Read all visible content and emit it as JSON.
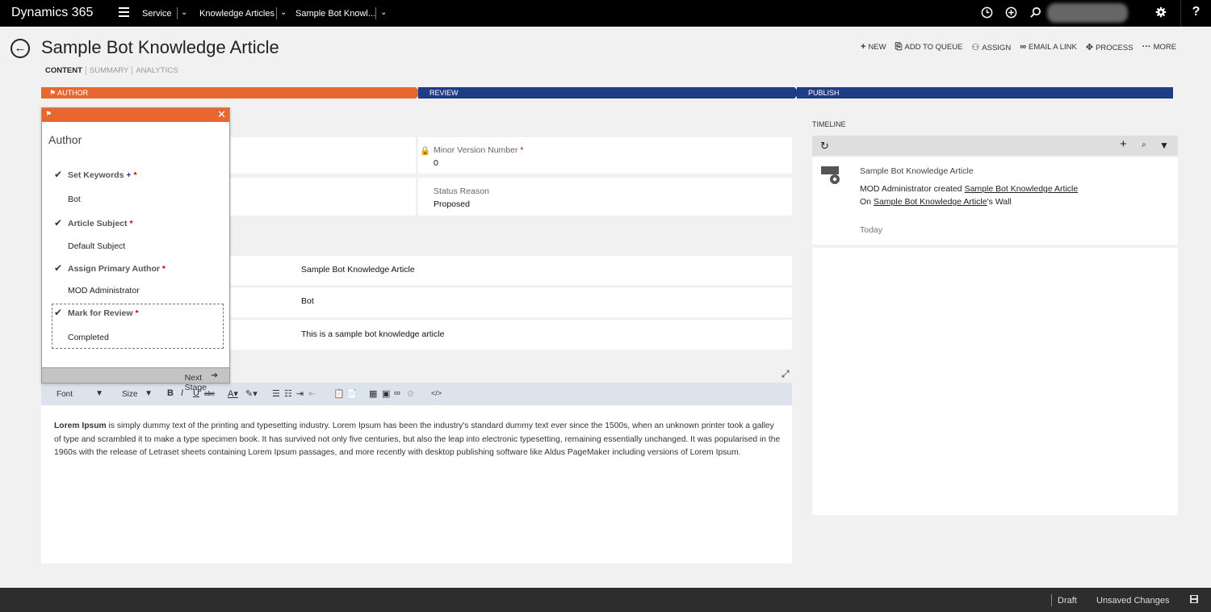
{
  "topbar": {
    "brand": "Dynamics 365",
    "crumbs": [
      "Service",
      "Knowledge Articles",
      "Sample Bot Knowl..."
    ],
    "help": "?"
  },
  "header": {
    "title": "Sample Bot Knowledge Article",
    "tabs": [
      "CONTENT",
      "SUMMARY",
      "ANALYTICS"
    ],
    "commands": [
      {
        "icon": "+",
        "label": "NEW"
      },
      {
        "icon": "⎘",
        "label": "ADD TO QUEUE"
      },
      {
        "icon": "👤",
        "label": "ASSIGN"
      },
      {
        "icon": "∞",
        "label": "EMAIL A LINK"
      },
      {
        "icon": "✥",
        "label": "PROCESS"
      },
      {
        "icon": "···",
        "label": "MORE"
      }
    ]
  },
  "stages": [
    "AUTHOR",
    "REVIEW",
    "PUBLISH"
  ],
  "flyout": {
    "title": "Author",
    "steps": [
      {
        "label": "Set Keywords",
        "value": "Bot"
      },
      {
        "label": "Article Subject",
        "value": "Default Subject"
      },
      {
        "label": "Assign Primary Author",
        "value": "MOD Administrator"
      },
      {
        "label": "Mark for Review",
        "value": "Completed"
      }
    ],
    "next_stage": "Next Stage"
  },
  "form": {
    "minor_version_label": "Minor Version Number",
    "minor_version_value": "0",
    "status_reason_label": "Status Reason",
    "status_reason_value": "Proposed",
    "title_value": "Sample Bot Knowledge Article",
    "keywords_value": "Bot",
    "description_value": "This is a sample bot knowledge article"
  },
  "editor": {
    "font_label": "Font",
    "size_label": "Size",
    "bold_lead": "Lorem Ipsum",
    "body": " is simply dummy text of the printing and typesetting industry. Lorem Ipsum has been the industry's standard dummy text ever since the 1500s, when an unknown printer took a galley of type and scrambled it to make a type specimen book. It has survived not only five centuries, but also the leap into electronic typesetting, remaining essentially unchanged. It was popularised in the 1960s with the release of Letraset sheets containing Lorem Ipsum passages, and more recently with desktop publishing software like Aldus PageMaker including versions of Lorem Ipsum."
  },
  "timeline": {
    "title": "TIMELINE",
    "post_title": "Sample Bot Knowledge Article",
    "author": "MOD Administrator",
    "created_word": "created",
    "link": "Sample Bot Knowledge Article",
    "on_word": "On",
    "wall_link": "Sample Bot Knowledge Article",
    "wall_suffix": "'s Wall",
    "when": "Today"
  },
  "status": {
    "state": "Draft",
    "changes": "Unsaved Changes"
  },
  "colors": {
    "accent_orange": "#e8672f",
    "stage_blue": "#1f3c86",
    "topbar": "#000000"
  }
}
